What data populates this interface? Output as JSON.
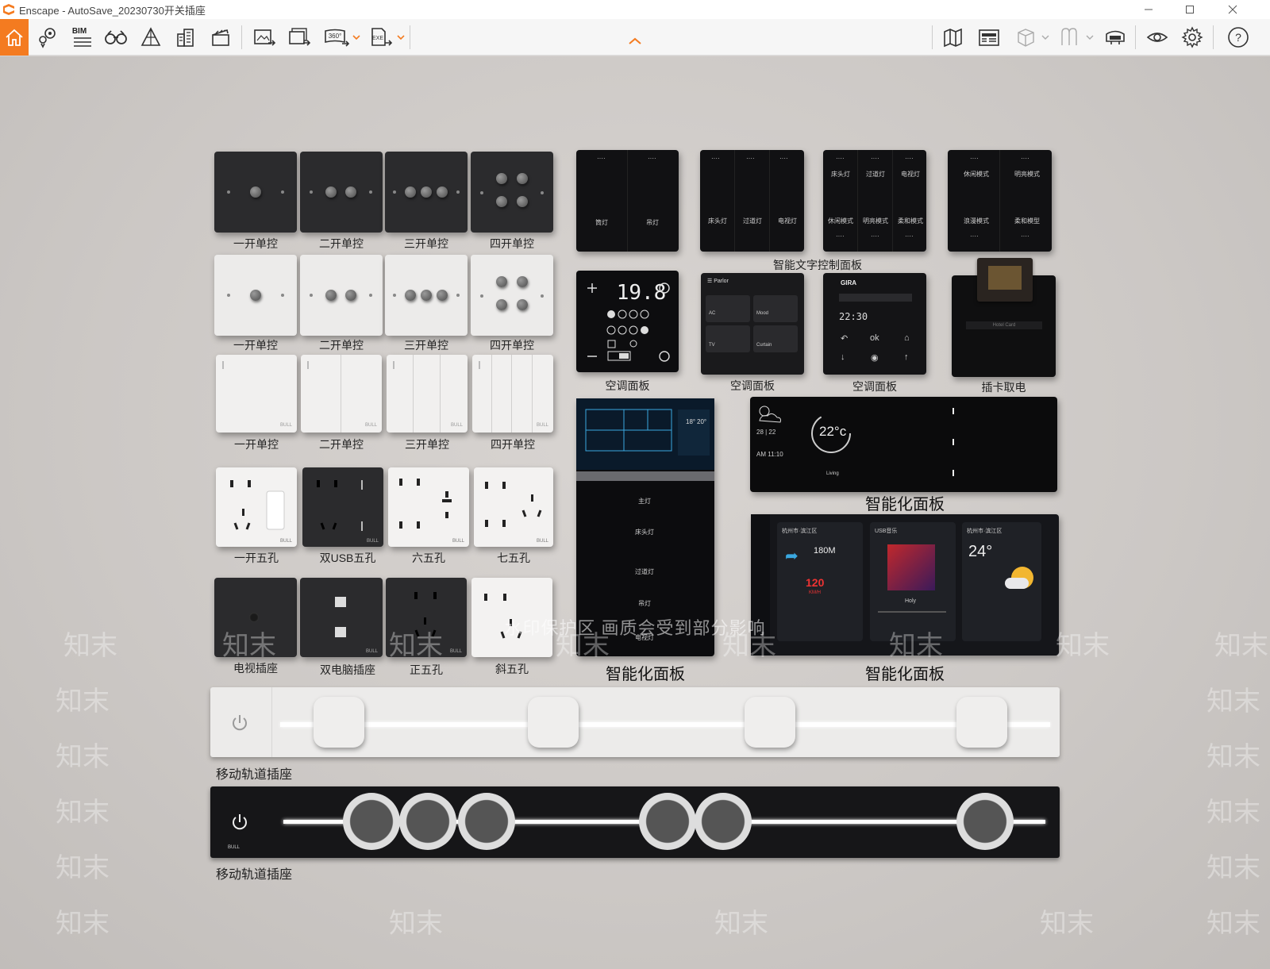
{
  "window": {
    "title": "Enscape - AutoSave_20230730开关插座"
  },
  "toolbar": {
    "bim_label": "BIM",
    "icons_left": [
      "home-icon",
      "location-pins-icon",
      "bim-icon",
      "binoculars-icon",
      "perspective-icon",
      "buildings-icon",
      "clapperboard-icon",
      "render-screenshot-icon",
      "batch-render-icon",
      "360-panorama-icon",
      "exe-export-icon"
    ],
    "icons_right": [
      "map-icon",
      "asset-library-icon",
      "cube-icon",
      "visual-presets-icon",
      "vr-headset-icon",
      "eye-icon",
      "gear-icon",
      "help-icon"
    ],
    "accent": "#f47b20"
  },
  "scene": {
    "watermark_text": "水印保护区    画质会受到部分影响",
    "watermark_logo": "知末",
    "captions": {
      "row1": [
        "一开单控",
        "二开单控",
        "三开单控",
        "四开单控"
      ],
      "row2": [
        "一开单控",
        "二开单控",
        "三开单控",
        "四开单控"
      ],
      "row3": [
        "一开单控",
        "二开单控",
        "三开单控",
        "四开单控"
      ],
      "row4": [
        "一开五孔",
        "双USB五孔",
        "六五孔",
        "七五孔"
      ],
      "row5": [
        "电视插座",
        "双电脑插座",
        "正五孔",
        "斜五孔"
      ],
      "smart_text_panel": "智能文字控制面板",
      "ac1": "空调面板",
      "ac2": "空调面板",
      "ac3": "空调面板",
      "card": "插卡取电",
      "smart1": "智能化面板",
      "smart2": "智能化面板",
      "smart3": "智能化面板",
      "rail1": "移动轨道插座",
      "rail2": "移动轨道插座"
    },
    "text_panels": {
      "p1": [
        "筒灯",
        "吊灯"
      ],
      "p2": [
        "床头灯",
        "过道灯",
        "电视灯"
      ],
      "p3_top": [
        "床头灯",
        "过道灯",
        "电视灯"
      ],
      "p3_bottom": [
        "休闲模式",
        "明亮模式",
        "柔和模式"
      ],
      "p4_top": [
        "休闲模式",
        "明亮模式"
      ],
      "p4_bottom": [
        "浪漫模式",
        "柔和模型"
      ]
    },
    "ac_panel1": {
      "temp": "19.8"
    },
    "ac_panel2": {
      "title": "Parlor",
      "labels": [
        "AC",
        "Mood",
        "TV",
        "Curtain"
      ]
    },
    "ac_panel3": {
      "brand": "GIRA",
      "time": "22:30",
      "ok": "ok"
    },
    "card_panel": {
      "slot_label": "Hotel Card"
    },
    "tall_panel": {
      "lines": [
        "主灯",
        "床头灯",
        "过道灯",
        "吊灯",
        "电视灯"
      ],
      "temps": [
        "18°",
        "20°"
      ]
    },
    "weather_panel": {
      "temp": "22°c",
      "date": "28 | 22",
      "time": "AM 11:10",
      "mode": "Living"
    },
    "media_panel": {
      "region1": "杭州市·滨江区",
      "distance": "180M",
      "speed": "120",
      "speed_unit": "KM/H",
      "music_label": "USB音乐",
      "song": "Holy",
      "region2": "杭州市·滨江区",
      "weather_temp": "24°"
    },
    "brand": "BULL"
  }
}
